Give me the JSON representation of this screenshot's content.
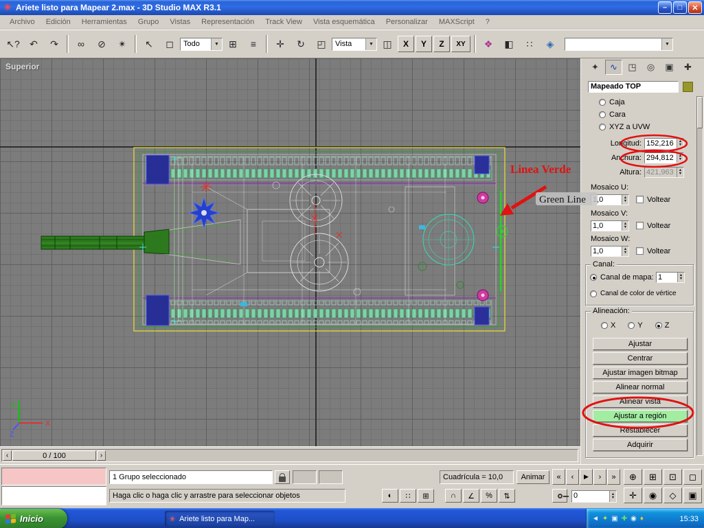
{
  "window": {
    "title": "Ariete listo para Mapear 2.max - 3D Studio MAX R3.1"
  },
  "menu": {
    "items": [
      "Archivo",
      "Edición",
      "Herramientas",
      "Grupo",
      "Vistas",
      "Representación",
      "Track View",
      "Vista esquemática",
      "Personalizar",
      "MAXScript",
      "?"
    ]
  },
  "toolbar": {
    "selection_filter": "Todo",
    "coord_system": "Vista",
    "axis_x": "X",
    "axis_y": "Y",
    "axis_z": "Z",
    "axis_xy": "XY"
  },
  "viewport": {
    "label": "Superior",
    "tripod_x": "X",
    "tripod_y": "Y",
    "tripod_z": "Z"
  },
  "annotations": {
    "label_red": "Linea Verde",
    "label_black": "Green Line"
  },
  "command_panel": {
    "modifier_name": "Mapeado TOP",
    "radio_caja": "Caja",
    "radio_cara": "Cara",
    "radio_xyz": "XYZ a UVW",
    "longitud_label": "Longitud:",
    "longitud_value": "152,216",
    "anchura_label": "Anchura:",
    "anchura_value": "294,812",
    "altura_label": "Altura:",
    "altura_value": "421,963",
    "mosaico_u_label": "Mosaico U:",
    "mosaico_u_value": "1,0",
    "mosaico_v_label": "Mosaico V:",
    "mosaico_v_value": "1,0",
    "mosaico_w_label": "Mosaico W:",
    "mosaico_w_value": "1,0",
    "voltear_label": "Voltear",
    "canal_title": "Canal:",
    "canal_mapa_label": "Canal de mapa:",
    "canal_mapa_value": "1",
    "canal_vertice_label": "Canal de color de vértice",
    "alineacion_title": "Alineación:",
    "align_x": "X",
    "align_y": "Y",
    "align_z": "Z",
    "buttons": [
      "Ajustar",
      "Centrar",
      "Ajustar imagen bitmap",
      "Alinear normal",
      "Alinear vista",
      "Ajustar a región",
      "Restablecer",
      "Adquirir"
    ]
  },
  "timeline": {
    "frame_display": "0 / 100"
  },
  "status": {
    "selection": "1 Grupo seleccionado",
    "prompt": "Haga clic o haga clic y arrastre para seleccionar objetos",
    "grid": "Cuadrícula = 10,0",
    "animate": "Animar",
    "frame_field": "0"
  },
  "taskbar": {
    "start": "Inicio",
    "task": "Ariete listo para Map...",
    "time": "15:33"
  },
  "icons": {
    "app": "✳",
    "window": [
      "–",
      "□",
      "✕"
    ],
    "toolbar": [
      "↖?",
      "↶",
      "↷",
      "∞",
      "⊘",
      "✴",
      "↖",
      "◻",
      "⊞",
      "≡",
      "✛",
      "↻",
      "◰",
      "◫",
      "❖",
      "◧",
      "∷",
      "◈"
    ],
    "panel_tabs": [
      "✦",
      "∿",
      "◳",
      "◎",
      "▣",
      "✚"
    ],
    "slider_prev": "‹",
    "slider_next": "›",
    "playback": [
      "«",
      "‹",
      "▶",
      "›",
      "»"
    ],
    "nav_row1": [
      "⊕",
      "⊞",
      "⊡",
      "◻"
    ],
    "nav_row2": [
      "✛",
      "◉",
      "◇",
      "▣"
    ],
    "status_misc": [
      "◐",
      "∷",
      "⊞"
    ],
    "snaps": [
      "∩",
      "∠",
      "%",
      "⇅"
    ],
    "tray": [
      "◄",
      "✦",
      "▣",
      "✚",
      "◉",
      "♦"
    ]
  }
}
